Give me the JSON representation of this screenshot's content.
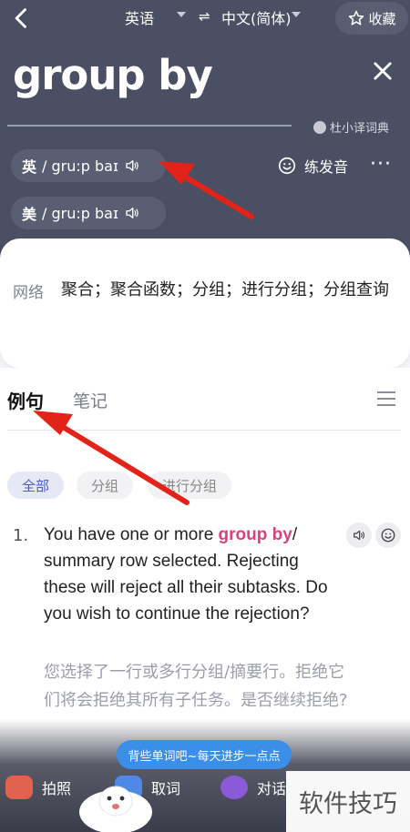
{
  "header": {
    "source_lang": "英语",
    "swap_icon": "swap-arrows-icon",
    "target_lang": "中文(简体)",
    "favorite_label": "收藏",
    "word": "group by",
    "dictionary_source": "杜小译词典"
  },
  "pronunciation": {
    "uk_tag": "英",
    "uk_phonetic": "/ gru:p baɪ",
    "us_tag": "美",
    "us_phonetic": "/ gru:p baɪ",
    "practice_label": "练发音",
    "more_label": "···"
  },
  "definition": {
    "label": "网络",
    "text": "聚合；聚合函数；分组；进行分组；分组查询"
  },
  "tabs": [
    {
      "label": "例句",
      "active": true
    },
    {
      "label": "笔记",
      "active": false
    }
  ],
  "filters": [
    "全部",
    "分组",
    "进行分组"
  ],
  "example": {
    "number": "1.",
    "en_before": "You have one or more ",
    "en_highlight": "group by",
    "en_after": "/ summary row selected. Rejecting these will reject all their subtasks. Do you wish to continue the rejection?",
    "cn": "您选择了一行或多行分组/摘要行。拒绝它们将会拒绝其所有子任务。是否继续拒绝?"
  },
  "bottom_bar": {
    "bubble": "背些单词吧~每天进步一点点",
    "photo_label": "拍照",
    "capture_label": "取词",
    "chat_label": "对话"
  },
  "watermark": "软件技巧",
  "colors": {
    "header_bg": "#4b4f63",
    "highlight": "#d6447a",
    "accent": "#4a5bd0",
    "annotation_arrow": "#e2231a"
  }
}
